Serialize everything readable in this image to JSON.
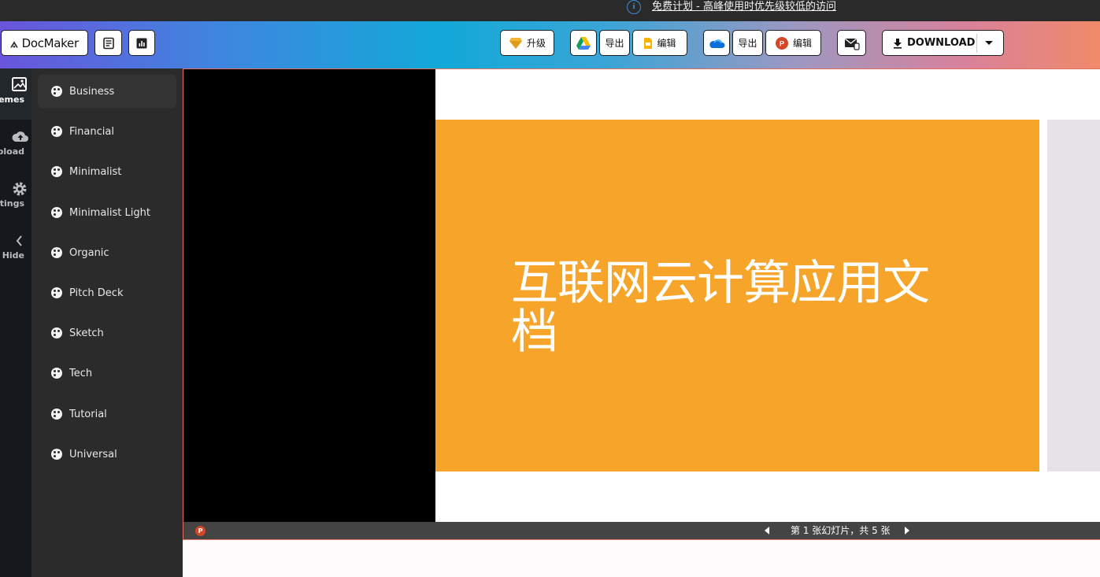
{
  "notice": {
    "icon": "info-icon",
    "text": "免费计划 - 高峰使用时优先级较低的访问"
  },
  "toolbar": {
    "logo_label": "DocMaker",
    "doc_icon": "document-icon",
    "chart_icon": "bar-chart-icon",
    "upgrade_label": "升级",
    "gdrive_export_label": "导出",
    "gdocs_edit_label": "编辑",
    "onedrive_export_label": "导出",
    "ppt_edit_label": "编辑",
    "mail_icon": "mail-icon",
    "download_label": "DOWNLOAD",
    "colors": {
      "brand_start": "#6a55dc",
      "brand_mid": "#12a9d8",
      "brand_end": "#f08a6a"
    }
  },
  "rail": {
    "items": [
      {
        "label": "Themes",
        "icon": "image-icon"
      },
      {
        "label": "Upload",
        "icon": "cloud-upload-icon"
      },
      {
        "label": "Settings",
        "icon": "gear-icon"
      },
      {
        "label": "Hide",
        "icon": "chevron-left-icon"
      }
    ]
  },
  "themes": {
    "items": [
      {
        "label": "Business",
        "active": true
      },
      {
        "label": "Financial"
      },
      {
        "label": "Minimalist"
      },
      {
        "label": "Minimalist Light"
      },
      {
        "label": "Organic"
      },
      {
        "label": "Pitch Deck"
      },
      {
        "label": "Sketch"
      },
      {
        "label": "Tech"
      },
      {
        "label": "Tutorial"
      },
      {
        "label": "Universal"
      }
    ]
  },
  "viewer": {
    "slide_title": "互联网云计算应用文档",
    "slide_color": "#f6a42a",
    "slide_counter": "第 1 张幻灯片，共 5 张"
  }
}
